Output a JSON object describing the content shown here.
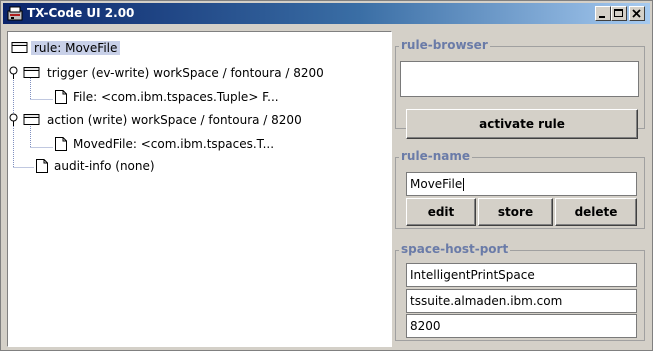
{
  "window": {
    "title": "TX-Code UI 2.00"
  },
  "tree": {
    "root": "rule: MoveFile",
    "trigger": "trigger (ev-write) workSpace / fontoura / 8200",
    "trigger_child": "File: <com.ibm.tspaces.Tuple> F...",
    "action": "action (write) workSpace / fontoura / 8200",
    "action_child": "MovedFile: <com.ibm.tspaces.T...",
    "audit": "audit-info (none)"
  },
  "rule_browser": {
    "title": "rule-browser",
    "value": ""
  },
  "activate_label": "activate rule",
  "rule_name": {
    "title": "rule-name",
    "value": "MoveFile",
    "edit_label": "edit",
    "store_label": "store",
    "delete_label": "delete"
  },
  "space_host_port": {
    "title": "space-host-port",
    "space": "IntelligentPrintSpace",
    "host": "tssuite.almaden.ibm.com",
    "port": "8200"
  },
  "colors": {
    "title_start": "#0a246a",
    "title_end": "#a6caf0",
    "group_title": "#6a7ba8",
    "selection": "#c8d0e8"
  },
  "icons": [
    "app-icon",
    "folder-icon",
    "document-icon",
    "tree-handle-icon",
    "minimize-icon",
    "maximize-icon",
    "close-icon"
  ]
}
